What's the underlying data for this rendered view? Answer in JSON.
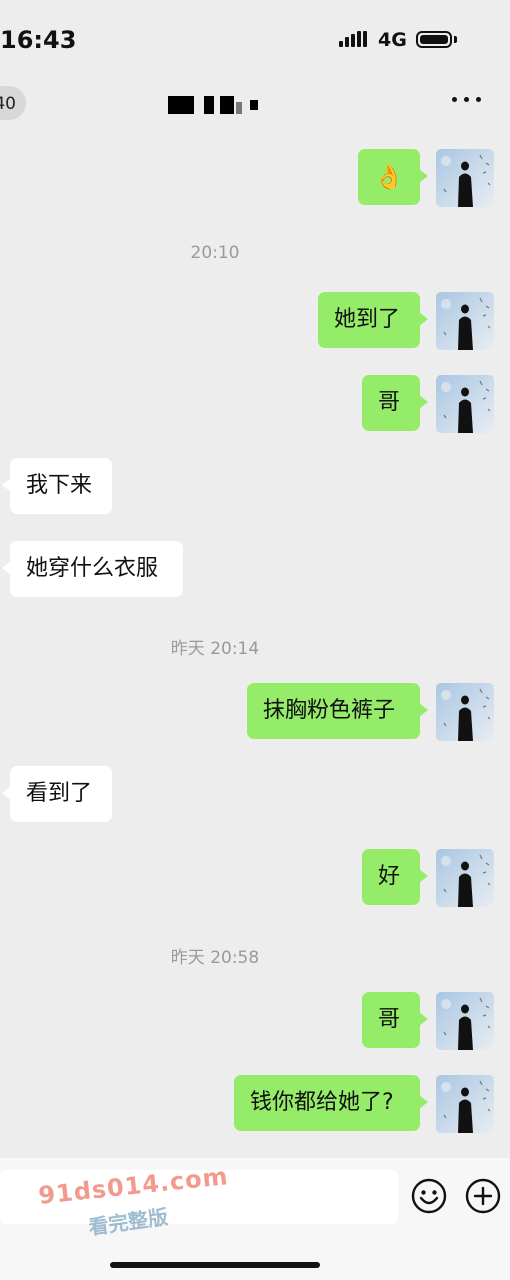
{
  "status_bar": {
    "time": "16:43",
    "network": "4G"
  },
  "nav": {
    "back_badge": "40"
  },
  "composer": {
    "watermark": "91ds014.com",
    "watermark_sub": "看完整版"
  },
  "messages": [
    {
      "type": "out",
      "text": "👌"
    },
    {
      "type": "time",
      "text": "20:10"
    },
    {
      "type": "out",
      "text": "她到了"
    },
    {
      "type": "out",
      "text": "哥"
    },
    {
      "type": "in",
      "text": "我下来"
    },
    {
      "type": "in",
      "text": "她穿什么衣服"
    },
    {
      "type": "time",
      "text": "昨天 20:14"
    },
    {
      "type": "out",
      "text": "抹胸粉色裤子"
    },
    {
      "type": "in",
      "text": "看到了"
    },
    {
      "type": "out",
      "text": "好"
    },
    {
      "type": "time",
      "text": "昨天 20:58"
    },
    {
      "type": "out",
      "text": "哥"
    },
    {
      "type": "out",
      "text": "钱你都给她了?"
    }
  ],
  "colors": {
    "outgoing_bubble": "#95ec69",
    "incoming_bubble": "#ffffff",
    "background": "#ededed"
  }
}
